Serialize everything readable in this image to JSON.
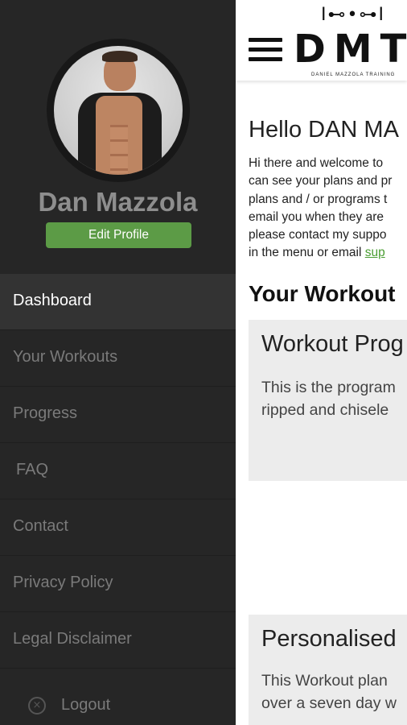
{
  "drawer": {
    "profile_name": "Dan Mazzola",
    "edit_profile_label": "Edit Profile",
    "nav_items": [
      {
        "label": "Dashboard",
        "active": true
      },
      {
        "label": "Your Workouts",
        "active": false
      },
      {
        "label": "Progress",
        "active": false
      },
      {
        "label": "FAQ",
        "active": false
      },
      {
        "label": "Contact",
        "active": false
      },
      {
        "label": "Privacy Policy",
        "active": false
      },
      {
        "label": "Legal Disclaimer",
        "active": false
      }
    ],
    "logout_label": "Logout",
    "logout_icon": "close-circle-icon"
  },
  "header": {
    "menu_icon": "hamburger-menu-icon",
    "logo_mark": "I⊷•⊶I",
    "logo_text": "DMT",
    "logo_subtitle": "DANIEL MAZZOLA TRAINING"
  },
  "main": {
    "greeting": "Hello DAN MA",
    "intro_lines": [
      "Hi there and welcome to",
      "can see your plans and pr",
      "plans and / or programs t",
      "email you when they are",
      "please contact my suppo",
      "in the menu or email "
    ],
    "intro_link": "sup",
    "section_title": "Your Workout",
    "cards": [
      {
        "title": "Workout Prog",
        "desc_lines": [
          "This is the program",
          "ripped and chisele"
        ]
      },
      {
        "title": "Personalised",
        "desc_lines": [
          "This Workout plan",
          "over a seven day w"
        ]
      }
    ]
  },
  "colors": {
    "drawer_bg": "#262626",
    "active_item_bg": "#333333",
    "accent_green": "#5c9b46",
    "link_green": "#4a9d32"
  }
}
